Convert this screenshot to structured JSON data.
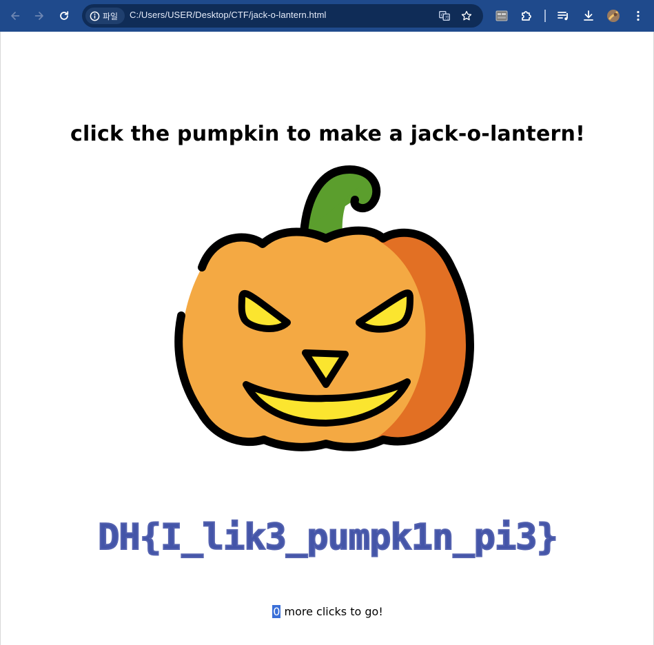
{
  "browser": {
    "site_chip_label": "파일",
    "url": "C:/Users/USER/Desktop/CTF/jack-o-lantern.html",
    "colors": {
      "toolbar": "#1f4a8c",
      "omnibox": "#0f2c57"
    },
    "icons": [
      "back-icon",
      "forward-icon",
      "reload-icon",
      "info-icon",
      "translate-icon",
      "star-icon",
      "extension-grid-icon",
      "puzzle-icon",
      "media-icon",
      "download-icon",
      "profile-avatar",
      "menu-icon"
    ]
  },
  "page": {
    "heading": "click the pumpkin to make a jack-o-lantern!",
    "flag": "DH{I_lik3_pumpk1n_pi3}",
    "clicks_remaining": "0",
    "clicks_suffix": " more clicks to go!",
    "colors": {
      "pumpkin_light": "#f4a943",
      "pumpkin_dark": "#e27024",
      "stem": "#5b9e2d",
      "eyes_mouth": "#fbe52f",
      "flag_text": "#4455a8",
      "highlight": "#3a6fd8"
    }
  }
}
